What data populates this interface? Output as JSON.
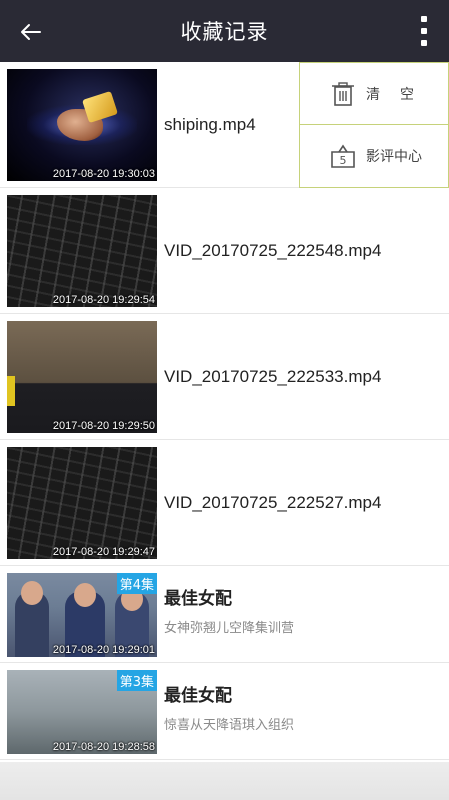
{
  "header": {
    "title": "收藏记录"
  },
  "menu": {
    "items": [
      {
        "label": "清空"
      },
      {
        "label": "影评中心"
      }
    ]
  },
  "list": [
    {
      "name": "shiping.mp4",
      "timestamp": "2017-08-20 19:30:03"
    },
    {
      "name": "VID_20170725_222548.mp4",
      "timestamp": "2017-08-20 19:29:54"
    },
    {
      "name": "VID_20170725_222533.mp4",
      "timestamp": "2017-08-20 19:29:50"
    },
    {
      "name": "VID_20170725_222527.mp4",
      "timestamp": "2017-08-20 19:29:47"
    },
    {
      "title": "最佳女配",
      "subtitle": "女神弥翘儿空降集训营",
      "episode": "第4集",
      "timestamp": "2017-08-20 19:29:01"
    },
    {
      "title": "最佳女配",
      "subtitle": "惊喜从天降语琪入组织",
      "episode": "第3集",
      "timestamp": "2017-08-20 19:28:58"
    }
  ],
  "icons": {
    "back": "back-arrow-icon",
    "more": "more-vert-icon",
    "clear": "trash-icon",
    "review": "review-center-icon"
  },
  "colors": {
    "header_bg": "#2a2a35",
    "episode_badge": "#25a5e4",
    "menu_border": "#c6d27a"
  }
}
